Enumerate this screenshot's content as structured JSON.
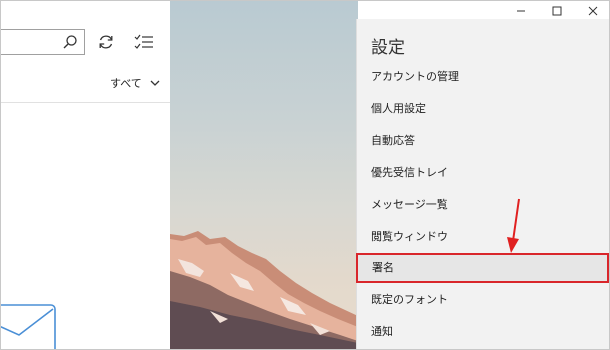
{
  "mail_list": {
    "filter_label": "すべて"
  },
  "settings_panel": {
    "title": "設定",
    "items": [
      {
        "label": "アカウントの管理"
      },
      {
        "label": "個人用設定"
      },
      {
        "label": "自動応答"
      },
      {
        "label": "優先受信トレイ"
      },
      {
        "label": "メッセージ一覧"
      },
      {
        "label": "閲覧ウィンドウ"
      },
      {
        "label": "署名",
        "selected": true
      },
      {
        "label": "既定のフォント"
      },
      {
        "label": "通知"
      }
    ]
  },
  "icons": [
    "search-icon",
    "sync-icon",
    "select-mode-icon",
    "chevron-down-icon",
    "mail-icon",
    "minimize-icon",
    "maximize-icon",
    "close-icon"
  ],
  "colors": {
    "highlight_border": "#d9262b",
    "annotation_arrow": "#e02020",
    "panel_bg": "#f2f2f2"
  }
}
